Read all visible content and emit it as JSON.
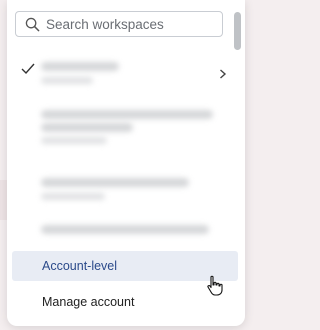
{
  "search": {
    "placeholder": "Search workspaces",
    "icon": "search-icon"
  },
  "workspaces": {
    "current": {
      "checked": true,
      "has_submenu": true
    }
  },
  "menu": {
    "account_level_label": "Account-level",
    "manage_account_label": "Manage account"
  },
  "colors": {
    "selected_bg": "#e8ecf4",
    "selected_text": "#2b4a8a"
  }
}
